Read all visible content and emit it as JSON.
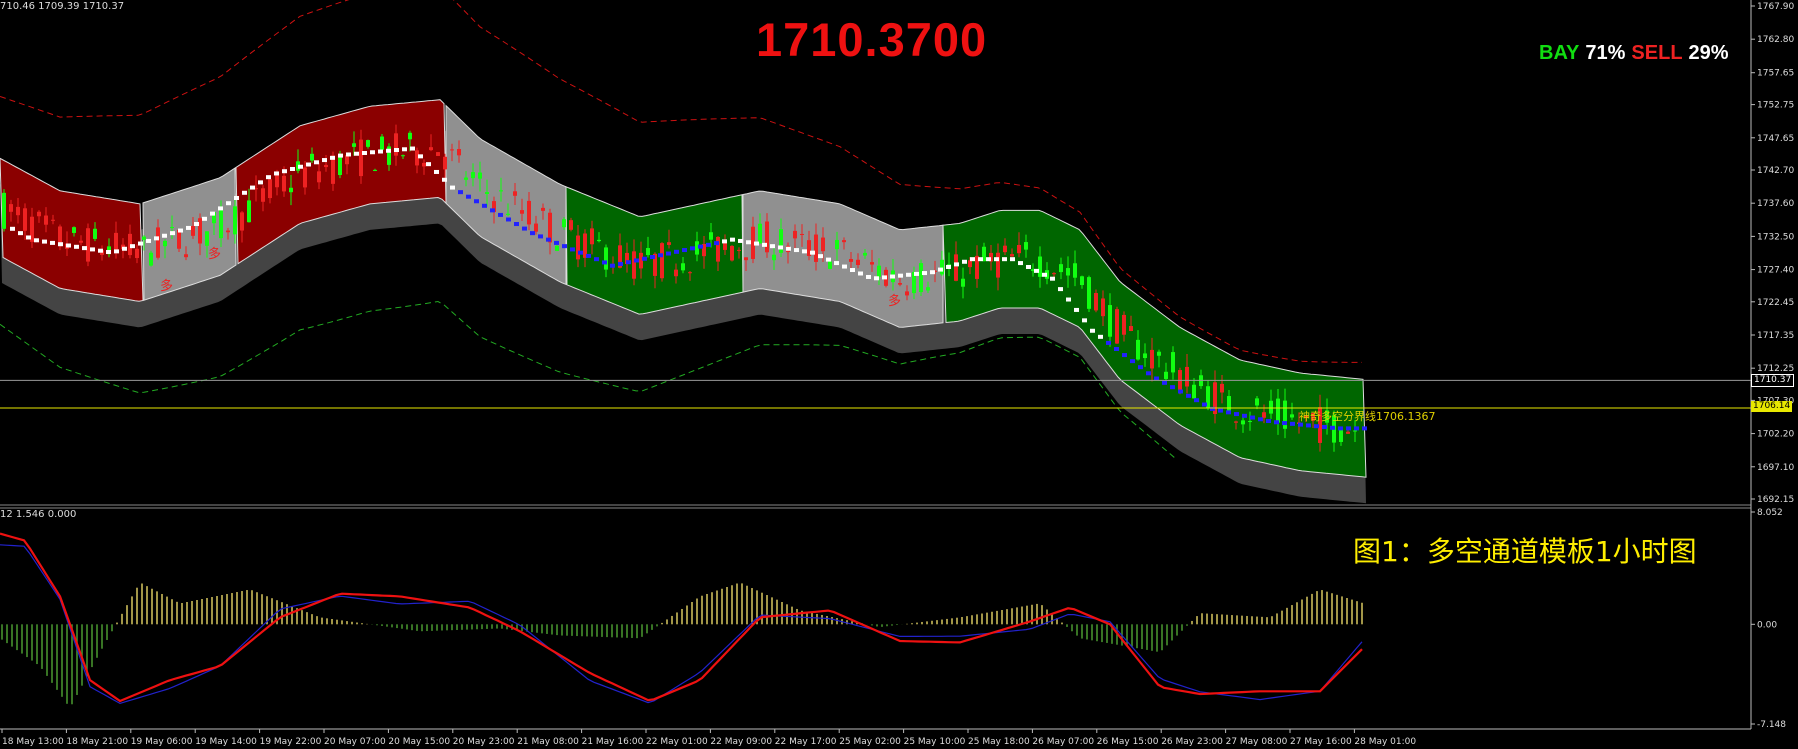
{
  "price_title": "1710.3700",
  "ohlc_text": "710.46 1709.39 1710.37",
  "indicator_header": "12 1.546 0.000",
  "bay_label": "BAY",
  "bay_pct": "71%",
  "sell_label": "SELL",
  "sell_pct": "29%",
  "caption": "图1：多空通道模板1小时图",
  "boundary_label": "神奇多空分界线1706.1367",
  "current_price_tag": "1710.37",
  "line_price_tag": "1706.14",
  "duo_marker": "多",
  "colors": {
    "bull_fill": "#006600",
    "bear_fill": "#8b0000",
    "neutral_fill": "#909090",
    "up_candle": "#11ff11",
    "down_candle": "#ee2222",
    "title_red": "#ee1111",
    "bay_green": "#11dd11",
    "sell_red": "#ee2222",
    "caption_yellow": "#ffee00",
    "signal_line": "#ee1111",
    "macd_line": "#2222cc"
  },
  "chart_data": [
    {
      "type": "line",
      "price_axis": {
        "ticks": [
          "1767.90",
          "1762.80",
          "1757.65",
          "1752.75",
          "1747.65",
          "1742.70",
          "1737.60",
          "1732.50",
          "1727.40",
          "1722.45",
          "1717.35",
          "1712.25",
          "1707.30",
          "1702.20",
          "1697.10",
          "1692.15"
        ]
      },
      "time_axis": {
        "ticks": [
          "18 May 13:00",
          "18 May 21:00",
          "19 May 06:00",
          "19 May 14:00",
          "19 May 22:00",
          "20 May 07:00",
          "20 May 15:00",
          "20 May 23:00",
          "21 May 08:00",
          "21 May 16:00",
          "22 May 01:00",
          "22 May 09:00",
          "22 May 17:00",
          "25 May 02:00",
          "25 May 10:00",
          "25 May 18:00",
          "26 May 07:00",
          "26 May 15:00",
          "26 May 23:00",
          "27 May 08:00",
          "27 May 16:00",
          "28 May 01:00"
        ]
      },
      "ylim": [
        1692.15,
        1767.9
      ],
      "current_price": 1710.37,
      "boundary_line": 1706.14,
      "channel_segments": [
        {
          "state": "bear",
          "end_price": 1745.0
        },
        {
          "state": "neutral",
          "end_price": 1741.0
        },
        {
          "state": "bear",
          "end_price": 1752.0
        },
        {
          "state": "neutral",
          "end_price": 1737.0
        },
        {
          "state": "bull",
          "end_price": 1731.0
        },
        {
          "state": "neutral",
          "end_price": 1735.0
        },
        {
          "state": "bull",
          "end_price": 1708.0
        }
      ]
    },
    {
      "type": "line",
      "ylim": [
        -7.148,
        8.052
      ],
      "ticks": [
        "8.052",
        "0.00",
        "-7.148"
      ],
      "series": []
    }
  ]
}
